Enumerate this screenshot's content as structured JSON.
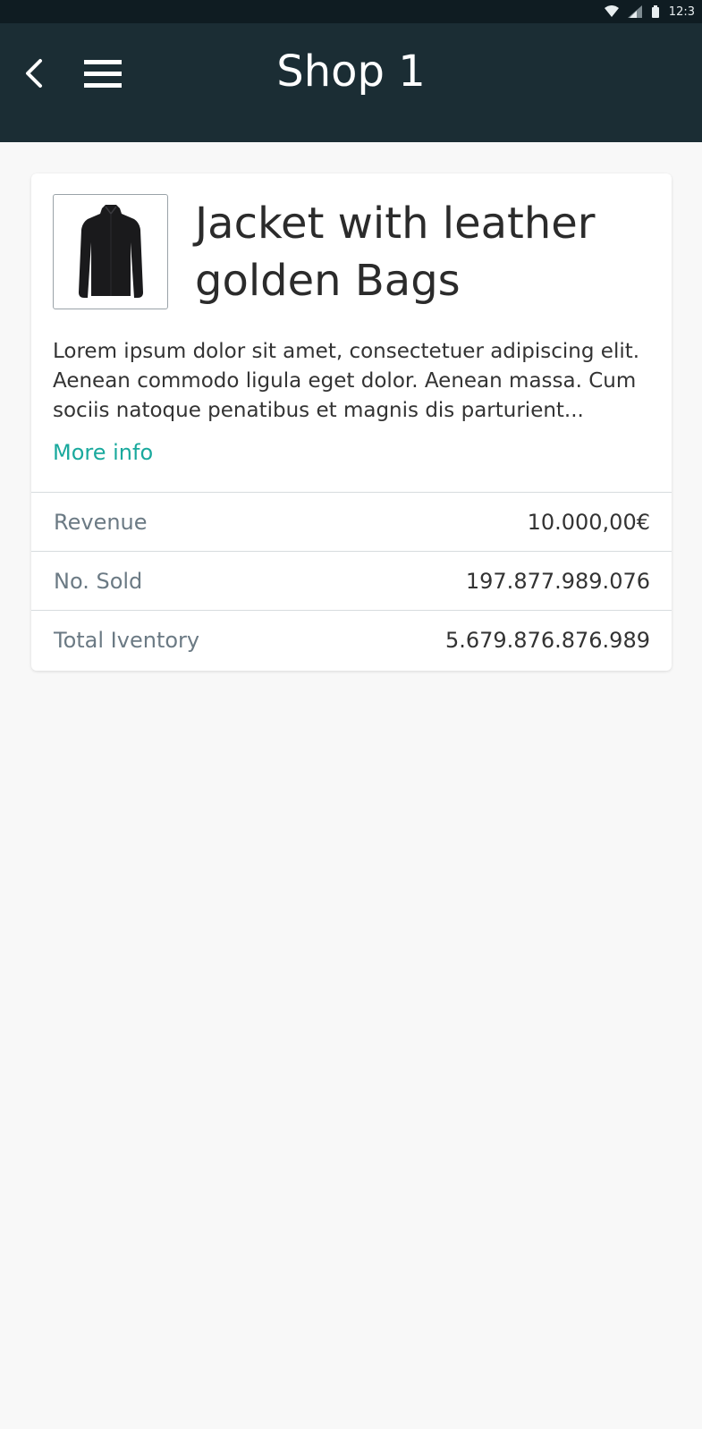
{
  "status_bar": {
    "time": "12:3",
    "icons": [
      "wifi-icon",
      "signal-icon",
      "battery-icon"
    ]
  },
  "app_bar": {
    "title": "Shop 1",
    "back_icon": "chevron-left-icon",
    "menu_icon": "hamburger-menu-icon",
    "background": "#1b2d34"
  },
  "product": {
    "title": "Jacket with leather golden Bags",
    "image": "black-jacket-thumbnail",
    "description": "Lorem ipsum dolor sit amet, consectetuer adipiscing elit. Aenean commodo ligula eget dolor. Aenean massa. Cum sociis natoque penatibus et magnis dis parturient...",
    "more_info_label": "More info",
    "accent": "#19a99d"
  },
  "stats": [
    {
      "label": "Revenue",
      "value": "10.000,00€"
    },
    {
      "label": "No. Sold",
      "value": "197.877.989.076"
    },
    {
      "label": "Total Iventory",
      "value": "5.679.876.876.989"
    }
  ]
}
